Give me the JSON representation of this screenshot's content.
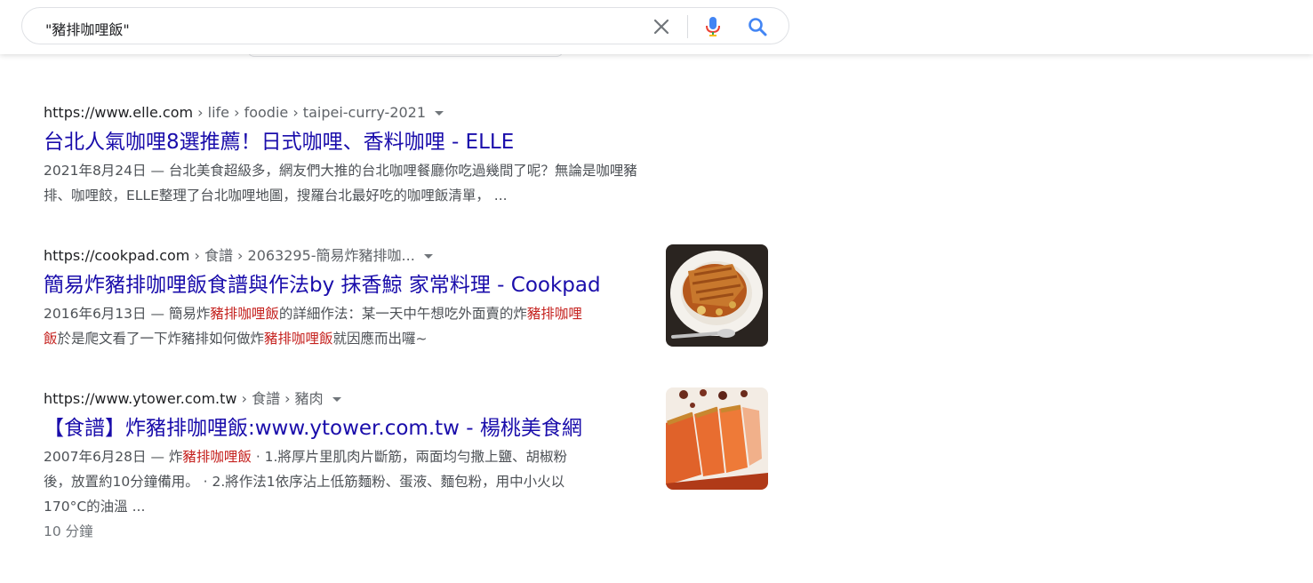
{
  "search": {
    "query": "\"豬排咖哩飯\""
  },
  "results": [
    {
      "domain": "https://www.elle.com",
      "path": " › life › foodie › taipei-curry-2021",
      "title": "台北人氣咖哩8選推薦！日式咖哩、香料咖哩 - ELLE",
      "snippet_line1": "2021年8月24日 — 台北美食超級多，網友們大推的台北咖哩餐廳你吃過幾間了呢？無論是咖哩豬",
      "snippet_line2": "排、咖哩餃，ELLE整理了台北咖哩地圖，搜羅台北最好吃的咖哩飯清單，  ..."
    },
    {
      "domain": "https://cookpad.com",
      "path": " › 食譜 › 2063295-簡易炸豬排咖...",
      "title": "簡易炸豬排咖哩飯食譜與作法by 抹香鯨 家常料理 - Cookpad",
      "s1": "2016年6月13日 — 簡易炸",
      "s2": "豬排咖哩飯",
      "s3": "的詳細作法：某一天中午想吃外面賣的炸",
      "s4": "豬排咖哩",
      "s5": "飯",
      "s6": "於是爬文看了一下炸豬排如何做炸",
      "s7": "豬排咖哩飯",
      "s8": "就因應而出囉~",
      "thumb_icon": "pork-cutlet-curry-plate"
    },
    {
      "domain": "https://www.ytower.com.tw",
      "path": " › 食譜 › 豬肉",
      "title": "【食譜】炸豬排咖哩飯:www.ytower.com.tw - 楊桃美食網",
      "s1": "2007年6月28日 — 炸",
      "s2": "豬排咖哩飯",
      "s3": " · 1.將厚片里肌肉片斷筋，兩面均勻撒上鹽、胡椒粉",
      "line2": "後，放置約10分鐘備用。 · 2.將作法1依序沾上低筋麵粉、蛋液、麵包粉，用中小火以",
      "line3": "170°C的油溫 ...",
      "duration": "10 分鐘",
      "thumb_icon": "fried-pork-cutlet"
    }
  ]
}
